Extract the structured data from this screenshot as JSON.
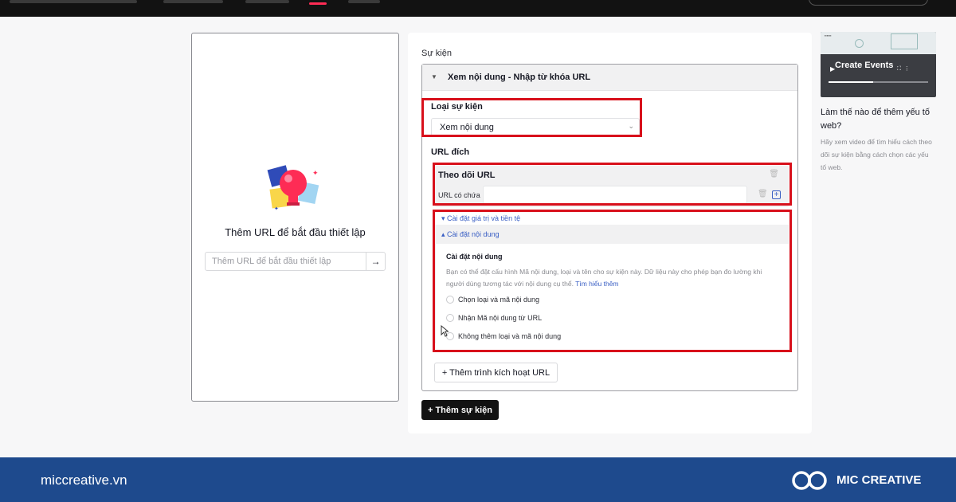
{
  "left_panel": {
    "title": "Thêm URL để bắt đầu thiết lập",
    "input_placeholder": "Thêm URL để bắt đầu thiết lập",
    "go_icon": "arrow-right-icon"
  },
  "events": {
    "section_label": "Sự kiện",
    "event_title": "Xem nội dung - Nhập từ khóa URL",
    "type_label": "Loại sự kiện",
    "type_value": "Xem nội dung",
    "dest_label": "URL đích",
    "track_title": "Theo dõi URL",
    "contains_label": "URL có chứa",
    "value_settings": "Cài đặt giá trị và tiền tệ",
    "content_settings_toggle": "Cài đặt nội dung",
    "content_settings_title": "Cài đặt nội dung",
    "content_desc": "Bạn có thể đặt cấu hình Mã nội dung, loại và tên cho sự kiện này. Dữ liệu này cho phép bạn đo lường khi người dùng tương tác với nội dung cụ thể.",
    "learn_more": "Tìm hiểu thêm",
    "options": [
      "Chọn loại và mã nội dung",
      "Nhận Mã nội dung từ URL",
      "Không thêm loại và mã nội dung"
    ],
    "add_trigger": "+ Thêm trình kích hoạt URL",
    "add_event": "+ Thêm sự kiện"
  },
  "help": {
    "video_title": "Create Events",
    "video_progress": 0.45,
    "title": "Làm thế nào để thêm yếu tố web?",
    "desc": "Hãy xem video để tìm hiểu cách theo dõi sự kiện bằng cách chọn các yếu tố web."
  },
  "footer": {
    "site": "miccreative.vn",
    "brand": "MIC CREATIVE"
  },
  "colors": {
    "highlight": "#d8101b",
    "link": "#3a5fc4",
    "footer_bg": "#1e4a8d",
    "accent": "#fe2c55"
  }
}
